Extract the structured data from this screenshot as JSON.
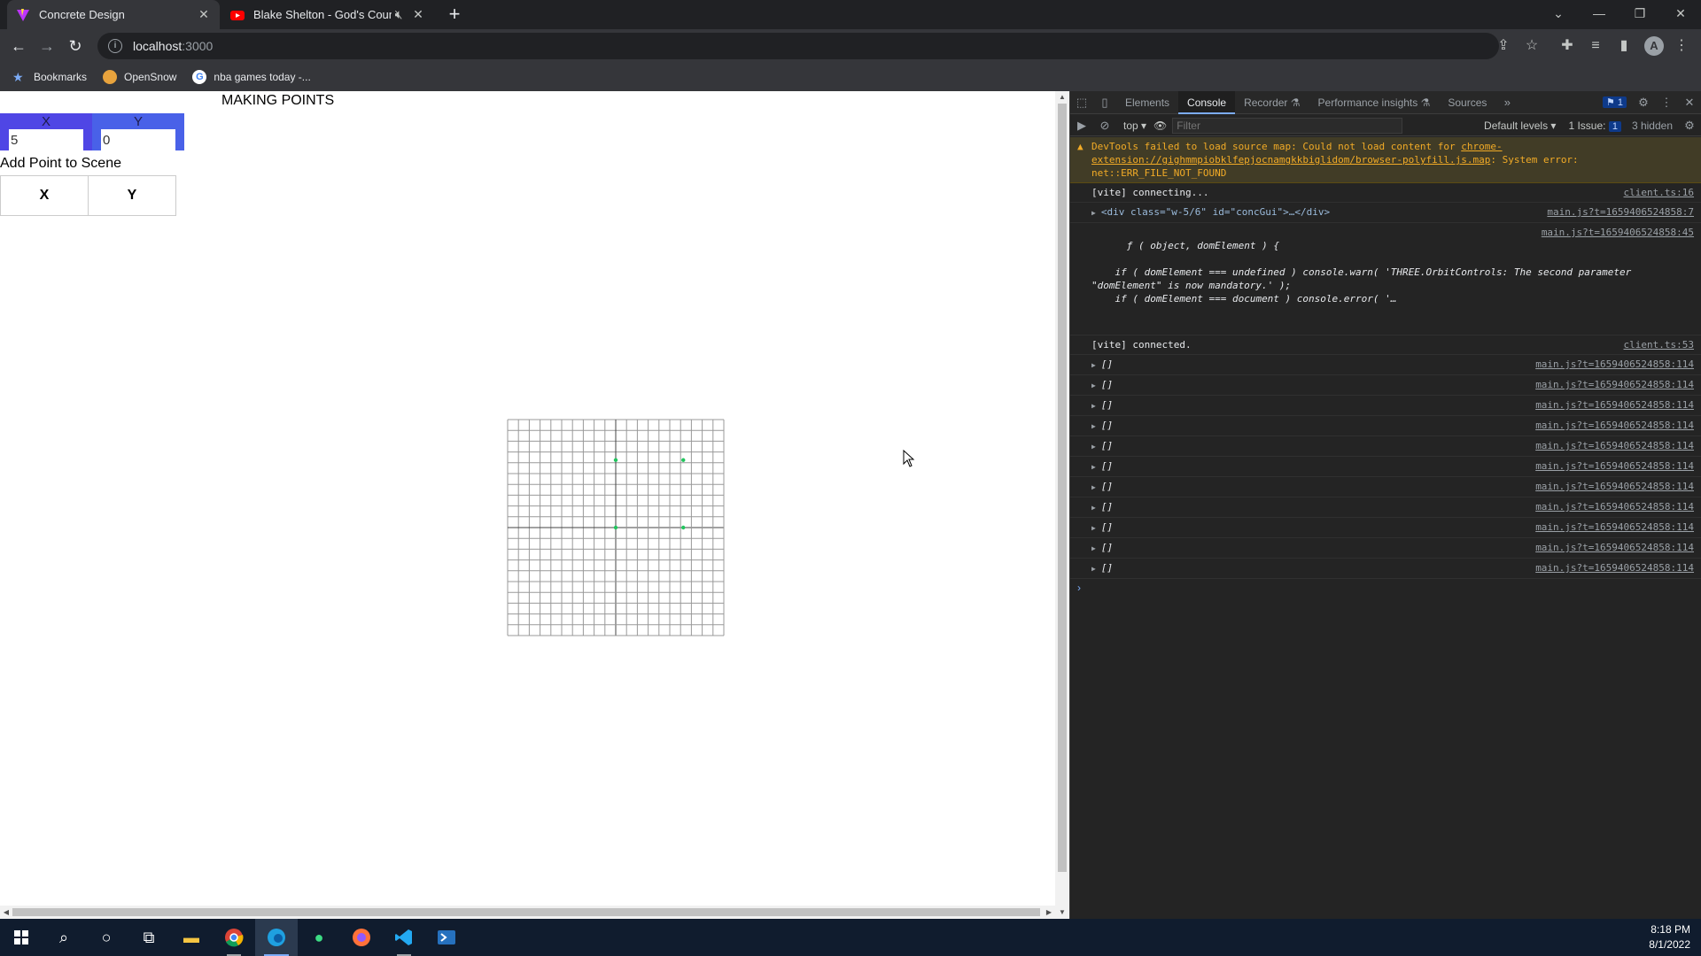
{
  "browser": {
    "tabs": [
      {
        "title": "Concrete Design",
        "active": true
      },
      {
        "title": "Blake Shelton - God's Countr",
        "active": false,
        "muted": true
      }
    ],
    "address": {
      "host": "localhost",
      "port": ":3000"
    },
    "bookmarks": [
      {
        "label": "Bookmarks",
        "icon": "star-icon"
      },
      {
        "label": "OpenSnow",
        "icon": "opensnow-icon"
      },
      {
        "label": "nba games today -...",
        "icon": "google-icon"
      }
    ]
  },
  "page": {
    "title": "MAKING POINTS",
    "inputs": {
      "x_label": "X",
      "y_label": "Y",
      "x_value": "5",
      "y_value": "0"
    },
    "add_point_label": "Add Point to Scene",
    "points_table": {
      "x_header": "X",
      "y_header": "Y"
    },
    "grid": {
      "divisions": 20,
      "points": [
        [
          0,
          5
        ],
        [
          5,
          5
        ],
        [
          0,
          0
        ],
        [
          5,
          0
        ]
      ],
      "point_color": "#22c55e"
    }
  },
  "devtools": {
    "tabs": [
      "Elements",
      "Console",
      "Recorder",
      "Performance insights",
      "Sources"
    ],
    "active_tab": "Console",
    "issue_count": "1",
    "context": "top",
    "filter_placeholder": "Filter",
    "levels": "Default levels",
    "issues_label": "1 Issue:",
    "issues_badge": "1",
    "hidden": "3 hidden",
    "warning": {
      "text": "DevTools failed to load source map: Could not load content for ",
      "link": "chrome-extension://gighmmpiobklfepjocnamgkkbiglidom/browser-polyfill.js.map",
      "suffix": ": System error: net::ERR_FILE_NOT_FOUND"
    },
    "logs": [
      {
        "text": "[vite] connecting...",
        "src": "client.ts:16"
      },
      {
        "text": "<div class=\"w-5/6\" id=\"concGui\">…</div>",
        "src": "main.js?t=1659406524858:7"
      },
      {
        "text": "ƒ ( object, domElement ) {\n\n    if ( domElement === undefined ) console.warn( 'THREE.OrbitControls: The second parameter \"domElement\" is now mandatory.' );\n    if ( domElement === document ) console.error( '…",
        "src": "main.js?t=1659406524858:45"
      },
      {
        "text": "[vite] connected.",
        "src": "client.ts:53"
      }
    ],
    "array_logs": {
      "text": "[]",
      "src": "main.js?t=1659406524858:114",
      "count": 11
    }
  },
  "taskbar": {
    "time": "8:18 PM",
    "date": "8/1/2022"
  }
}
